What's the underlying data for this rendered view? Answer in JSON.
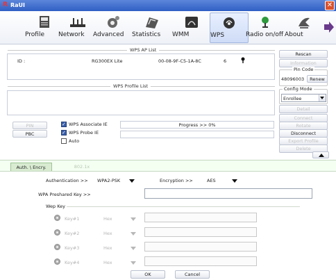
{
  "app": {
    "title": "RaUI"
  },
  "toolbar": {
    "items": [
      {
        "label": "Profile"
      },
      {
        "label": "Network"
      },
      {
        "label": "Advanced"
      },
      {
        "label": "Statistics"
      },
      {
        "label": "WMM"
      },
      {
        "label": "WPS"
      },
      {
        "label": "Radio on/off"
      },
      {
        "label": "About"
      }
    ],
    "active": "WPS"
  },
  "wps_ap_list": {
    "header": "WPS AP List",
    "id_label": "ID :",
    "row": {
      "name": "RG300EX Lite",
      "mac": "00-08-9F-C5-1A-8C",
      "channel": "6"
    }
  },
  "wps_profile_list": {
    "header": "WPS Profile List"
  },
  "right": {
    "rescan": "Rescan",
    "information": "Information",
    "pin_code_label": "Pin Code",
    "pin_code_value": "48096003",
    "renew": "Renew",
    "config_mode_label": "Config Mode",
    "config_mode_value": "Enrollee",
    "detail": "Detail",
    "connect": "Connect",
    "rotate": "Rotate",
    "disconnect": "Disconnect",
    "export_profile": "Export Profile",
    "delete": "Delete"
  },
  "controls": {
    "pin": "PIN",
    "pbc": "PBC",
    "wps_associate_ie": "WPS Associate IE",
    "wps_probe_ie": "WPS Probe IE",
    "auto": "Auto",
    "progress": "Progress >> 0%"
  },
  "tabs": {
    "auth": "Auth. \\ Encry.",
    "dot1x": "802.1x"
  },
  "auth": {
    "authentication_label": "Authentication >>",
    "authentication_value": "WPA2-PSK",
    "encryption_label": "Encryption >>",
    "encryption_value": "AES",
    "wpa_key_label": "WPA Preshared Key >>",
    "wep_key_label": "Wep Key",
    "keys": [
      {
        "label": "Key#1",
        "type": "Hex"
      },
      {
        "label": "Key#2",
        "type": "Hex"
      },
      {
        "label": "Key#3",
        "type": "Hex"
      },
      {
        "label": "Key#4",
        "type": "Hex"
      }
    ]
  },
  "footer": {
    "ok": "OK",
    "cancel": "Cancel"
  }
}
